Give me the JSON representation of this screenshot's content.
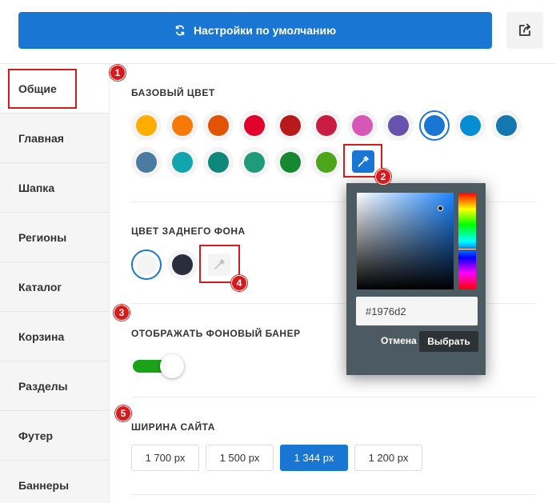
{
  "header": {
    "reset_label": "Настройки по умолчанию",
    "reset_icon": "refresh-icon",
    "share_icon": "share-icon"
  },
  "sidebar": {
    "items": [
      {
        "label": "Общие",
        "active": true
      },
      {
        "label": "Главная"
      },
      {
        "label": "Шапка"
      },
      {
        "label": "Регионы"
      },
      {
        "label": "Каталог"
      },
      {
        "label": "Корзина"
      },
      {
        "label": "Разделы"
      },
      {
        "label": "Футер"
      },
      {
        "label": "Баннеры"
      }
    ]
  },
  "markers": [
    "1",
    "2",
    "3",
    "4",
    "5"
  ],
  "base_color": {
    "title": "БАЗОВЫЙ ЦВЕТ",
    "selected": "#1976d2",
    "colors": [
      "#ffad00",
      "#f77a08",
      "#e05400",
      "#e0002b",
      "#b81a1c",
      "#c81c42",
      "#d757b9",
      "#6752af",
      "#1976d2",
      "#068dd2",
      "#1477b0",
      "#4a7ba0",
      "#12a5ad",
      "#0e887b",
      "#1e9b78",
      "#178731",
      "#4da51a"
    ],
    "custom_button_icon": "eyedropper-icon"
  },
  "background_color": {
    "title": "ЦВЕТ ЗАДНЕГО ФОНА",
    "colors": [
      "#f4f4f4",
      "#2a2d3b"
    ],
    "selected": "#f4f4f4",
    "custom_button_icon": "eyedropper-icon"
  },
  "banner": {
    "title": "ОТОБРАЖАТЬ ФОНОВЫЙ БАНЕР",
    "enabled": true
  },
  "site_width": {
    "title": "ШИРИНА САЙТА",
    "options": [
      "1 700 px",
      "1 500 px",
      "1 344 px",
      "1 200 px"
    ],
    "selected": "1 344 px"
  },
  "color_picker": {
    "hex_value": "#1976d2",
    "cancel_label": "Отмена",
    "choose_label": "Выбрать"
  }
}
